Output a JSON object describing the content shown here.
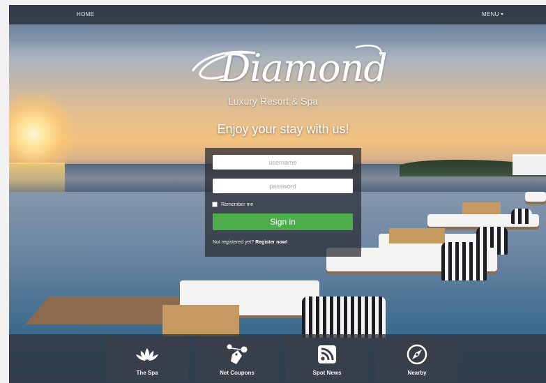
{
  "nav": {
    "home": "HOME",
    "menu": "MENU"
  },
  "brand": {
    "name": "Diamond",
    "subtitle": "Luxury Resort & Spa"
  },
  "tagline": "Enjoy your stay with us!",
  "login": {
    "username_placeholder": "username",
    "password_placeholder": "password",
    "remember": "Remember me",
    "signin": "Sign in",
    "register_prefix": "Not registered yet?",
    "register_link": "Register now!"
  },
  "tiles": [
    {
      "label": "The Spa",
      "icon": "lotus-icon"
    },
    {
      "label": "Net Coupons",
      "icon": "coupon-tag-icon"
    },
    {
      "label": "Spot News",
      "icon": "rss-icon"
    },
    {
      "label": "Nearby",
      "icon": "compass-icon"
    }
  ],
  "colors": {
    "signin_green": "#4cad4a",
    "panel": "#282a30",
    "nav": "#282c34"
  }
}
